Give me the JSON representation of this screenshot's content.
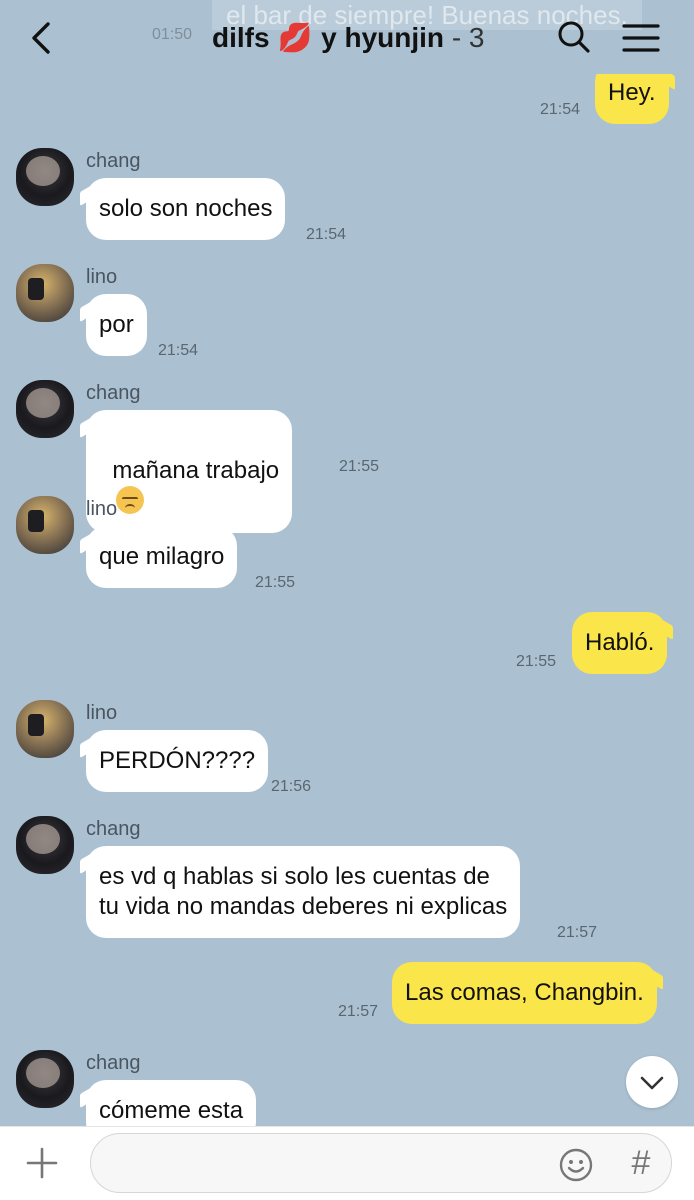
{
  "header": {
    "ghost_text": "el bar de siempre! Buenas noches.",
    "ghost_time": "01:50",
    "title_prefix": "dilfs",
    "title_emoji": "💋",
    "title_suffix": "y hyunjin",
    "member_count": "- 3"
  },
  "messages": [
    {
      "side": "out",
      "text": "Hey.",
      "time": "21:54"
    },
    {
      "side": "in",
      "sender": "chang",
      "text": "solo son noches",
      "time": "21:54"
    },
    {
      "side": "in",
      "sender": "lino",
      "text": "por",
      "time": "21:54"
    },
    {
      "side": "in",
      "sender": "chang",
      "text": "mañana trabajo",
      "emoji": "disappointed-face",
      "time": "21:55"
    },
    {
      "side": "in",
      "sender": "lino",
      "text": "que milagro",
      "time": "21:55"
    },
    {
      "side": "out",
      "text": "Habló.",
      "time": "21:55"
    },
    {
      "side": "in",
      "sender": "lino",
      "text": "PERDÓN????",
      "time": "21:56"
    },
    {
      "side": "in",
      "sender": "chang",
      "text": "es vd q hablas si solo les cuentas de\ntu vida no mandas deberes ni explicas",
      "time": "21:57"
    },
    {
      "side": "out",
      "text": "Las comas, Changbin.",
      "time": "21:57"
    },
    {
      "side": "in",
      "sender": "chang",
      "text": "cómeme esta",
      "time": ""
    }
  ],
  "input": {
    "placeholder": "",
    "hash_label": "#"
  },
  "colors": {
    "background": "#abc1d1",
    "outgoing_bubble": "#fae54b",
    "incoming_bubble": "#ffffff"
  },
  "icons": {
    "back": "chevron-left-icon",
    "search": "search-icon",
    "menu": "hamburger-menu-icon",
    "scroll": "chevron-down-icon",
    "plus": "plus-icon",
    "emoji": "smiley-icon"
  }
}
